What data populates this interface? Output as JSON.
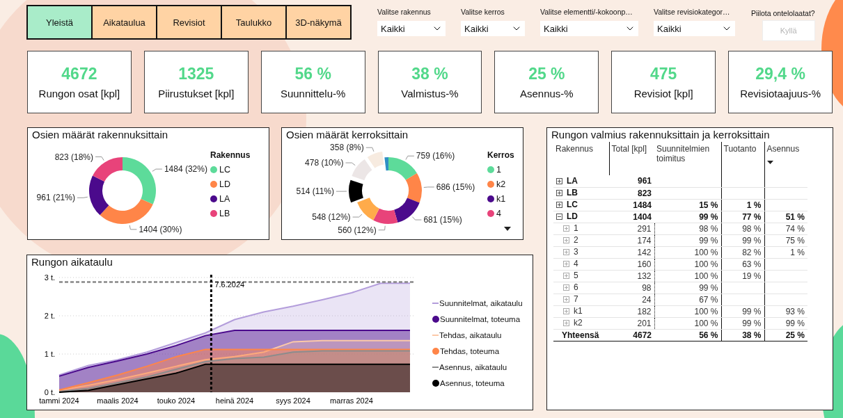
{
  "tabs": [
    {
      "label": "Yleistä",
      "selected": true
    },
    {
      "label": "Aikataulua",
      "selected": false
    },
    {
      "label": "Revisiot",
      "selected": false
    },
    {
      "label": "Taulukko",
      "selected": false
    },
    {
      "label": "3D-näkymä",
      "selected": false
    }
  ],
  "filters": [
    {
      "label": "Valitse rakennus",
      "value": "Kaikki"
    },
    {
      "label": "Valitse kerros",
      "value": "Kaikki"
    },
    {
      "label": "Valitse elementti/-kokoonp…",
      "value": "Kaikki"
    },
    {
      "label": "Valitse revisiokategor…",
      "value": "Kaikki"
    }
  ],
  "toggle": {
    "label": "Piilota ontelolaatat?",
    "button": "Kyllä",
    "selected": false
  },
  "kpis": [
    {
      "value": "4672",
      "label": "Rungon osat [kpl]"
    },
    {
      "value": "1325",
      "label": "Piirustukset [kpl]"
    },
    {
      "value": "56 %",
      "label": "Suunnittelu-%"
    },
    {
      "value": "38 %",
      "label": "Valmistus-%"
    },
    {
      "value": "25 %",
      "label": "Asennus-%"
    },
    {
      "value": "475",
      "label": "Revisiot [kpl]"
    },
    {
      "value": "29,4 %",
      "label": "Revisiotaajuus-%"
    }
  ],
  "building_chart": {
    "title": "Osien määrät rakennuksittain",
    "chart_data": {
      "type": "donut",
      "values": [
        1484,
        1404,
        961,
        823
      ],
      "value_labels": [
        "1484 (32%)",
        "1404 (30%)",
        "961 (21%)",
        "823 (18%)"
      ],
      "colors": [
        "#5ddb9a",
        "#ff8548",
        "#4b0a8c",
        "#e8437a"
      ]
    },
    "legend": {
      "title": "Rakennus",
      "items": [
        {
          "label": "LC",
          "color": "#5ddb9a"
        },
        {
          "label": "LD",
          "color": "#ff8548"
        },
        {
          "label": "LA",
          "color": "#4b0a8c"
        },
        {
          "label": "LB",
          "color": "#e8437a"
        }
      ]
    }
  },
  "floor_chart": {
    "title": "Osien määrät kerroksittain",
    "chart_data": {
      "type": "donut",
      "values": [
        759,
        686,
        681,
        560,
        548,
        514,
        478,
        358,
        88
      ],
      "value_labels": [
        "759 (16%)",
        "686 (15%)",
        "681 (15%)",
        "560 (12%)",
        "548 (12%)",
        "514 (11%)",
        "478 (10%)",
        "358 (8%)",
        null
      ],
      "colors": [
        "#5ddb9a",
        "#ff8548",
        "#4b0a8c",
        "#e8437a",
        "#ffab4a",
        "#000000",
        "#ece6e6",
        "#f7ebe0",
        "#2f8fc4"
      ]
    },
    "exploded": [
      false,
      false,
      false,
      false,
      false,
      true,
      true,
      true,
      false
    ],
    "legend": {
      "title": "Kerros",
      "items": [
        {
          "label": "1",
          "color": "#5ddb9a"
        },
        {
          "label": "k2",
          "color": "#ff8548"
        },
        {
          "label": "k1",
          "color": "#4b0a8c"
        },
        {
          "label": "4",
          "color": "#e8437a"
        }
      ]
    }
  },
  "schedule_chart": {
    "title": "Rungon aikataulu",
    "chart_data": {
      "type": "area",
      "categories": [
        "tammi 2024",
        null,
        "maalis 2024",
        null,
        "touko 2024",
        null,
        "heinä 2024",
        null,
        "syys 2024",
        null,
        "marras 2024",
        null,
        null
      ],
      "ylim": [
        0,
        3
      ],
      "yticks": [
        {
          "value": 0,
          "label": "0 t."
        },
        {
          "value": 1,
          "label": "1 t."
        },
        {
          "value": 2,
          "label": "2 t."
        },
        {
          "value": 3,
          "label": "3 t."
        }
      ],
      "series": [
        {
          "name": "Suunnitelmat, aikataulu",
          "color": "#b39ddb",
          "values": [
            0.45,
            0.7,
            0.85,
            1.05,
            1.3,
            1.55,
            1.9,
            2.1,
            2.25,
            2.42,
            2.6,
            2.85,
            2.85
          ]
        },
        {
          "name": "Suunnitelmat, toteuma",
          "color": "#4b0a8c",
          "values": [
            0.42,
            0.65,
            0.82,
            1.0,
            1.22,
            1.48,
            1.62,
            1.62,
            1.62,
            1.62,
            1.62,
            1.62,
            1.62
          ]
        },
        {
          "name": "Tehdas, aikataulu",
          "color": "#fcc9a8",
          "values": [
            0.05,
            0.18,
            0.33,
            0.5,
            0.68,
            0.85,
            0.93,
            1.05,
            1.32,
            1.35,
            1.35,
            1.35,
            1.35
          ]
        },
        {
          "name": "Tehdas, toteuma",
          "color": "#ff8548",
          "values": [
            0.06,
            0.25,
            0.45,
            0.68,
            0.93,
            1.12,
            1.12,
            1.12,
            1.12,
            1.12,
            1.12,
            1.12,
            1.12
          ]
        },
        {
          "name": "Asennus, aikataulu",
          "color": "#8c8c8c",
          "values": [
            0.02,
            0.1,
            0.25,
            0.4,
            0.6,
            0.8,
            0.88,
            0.92,
            1.05,
            1.08,
            1.08,
            1.08,
            1.08
          ]
        },
        {
          "name": "Asennus, toteuma",
          "color": "#000000",
          "values": [
            0.0,
            0.05,
            0.2,
            0.35,
            0.5,
            0.73,
            0.73,
            0.73,
            0.73,
            0.73,
            0.73,
            0.73,
            0.73
          ]
        }
      ],
      "ref_lines": [
        {
          "axis": "y",
          "value": 2.88
        }
      ]
    },
    "date_marker": "7.6.2024",
    "legend_markers": [
      {
        "kind": "line"
      },
      {
        "kind": "dot"
      },
      {
        "kind": "line"
      },
      {
        "kind": "dot"
      },
      {
        "kind": "line"
      },
      {
        "kind": "dot"
      }
    ]
  },
  "progress_table": {
    "title": "Rungon valmius rakennuksittain ja kerroksittain",
    "columns": [
      "Rakennus",
      "Total [kpl]",
      "Suunnitelmien toimitus",
      "Tuotanto",
      "Asennus"
    ],
    "rows": [
      {
        "kind": "building",
        "expanded": false,
        "cells": [
          "LA",
          "961",
          null,
          null,
          null
        ]
      },
      {
        "kind": "building",
        "expanded": false,
        "cells": [
          "LB",
          "823",
          null,
          null,
          null
        ]
      },
      {
        "kind": "building",
        "expanded": false,
        "cells": [
          "LC",
          "1484",
          "15 %",
          "1 %",
          null
        ]
      },
      {
        "kind": "building",
        "expanded": true,
        "cells": [
          "LD",
          "1404",
          "99 %",
          "77 %",
          "51 %"
        ]
      },
      {
        "kind": "floor",
        "expanded": false,
        "cells": [
          "1",
          "291",
          "98 %",
          "98 %",
          "74 %"
        ]
      },
      {
        "kind": "floor",
        "expanded": false,
        "cells": [
          "2",
          "174",
          "99 %",
          "99 %",
          "75 %"
        ]
      },
      {
        "kind": "floor",
        "expanded": false,
        "cells": [
          "3",
          "142",
          "100 %",
          "82 %",
          "1 %"
        ]
      },
      {
        "kind": "floor",
        "expanded": false,
        "cells": [
          "4",
          "160",
          "100 %",
          "63 %",
          null
        ]
      },
      {
        "kind": "floor",
        "expanded": false,
        "cells": [
          "5",
          "132",
          "100 %",
          "19 %",
          null
        ]
      },
      {
        "kind": "floor",
        "expanded": false,
        "cells": [
          "6",
          "98",
          "99 %",
          null,
          null
        ]
      },
      {
        "kind": "floor",
        "expanded": false,
        "cells": [
          "7",
          "24",
          "67 %",
          null,
          null
        ]
      },
      {
        "kind": "floor",
        "expanded": false,
        "cells": [
          "k1",
          "182",
          "100 %",
          "99 %",
          "93 %"
        ]
      },
      {
        "kind": "floor",
        "expanded": false,
        "cells": [
          "k2",
          "201",
          "100 %",
          "99 %",
          "99 %"
        ]
      },
      {
        "kind": "total",
        "cells": [
          "Yhteensä",
          "4672",
          "56 %",
          "38 %",
          "25 %"
        ]
      }
    ]
  }
}
